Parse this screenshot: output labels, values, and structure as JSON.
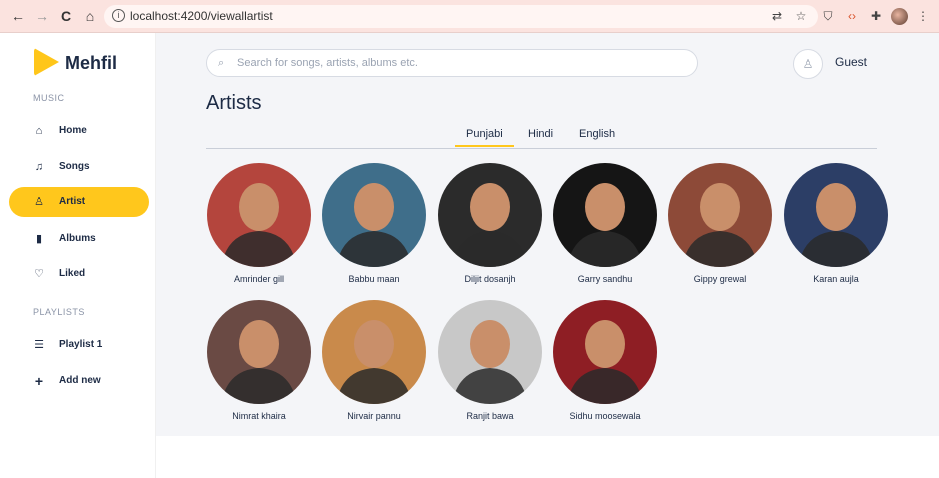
{
  "browser": {
    "url": "localhost:4200/viewallartist",
    "back": "←",
    "forward": "→",
    "reload": "C",
    "home": "⌂"
  },
  "sidebar": {
    "brand": "Mehfil",
    "music_section": "MUSIC",
    "playlists_section": "PLAYLISTS",
    "items": [
      {
        "label": "Home",
        "icon": "home-icon",
        "glyph": "⌂"
      },
      {
        "label": "Songs",
        "icon": "music-note-icon",
        "glyph": "♫"
      },
      {
        "label": "Artist",
        "icon": "person-icon",
        "glyph": "♙"
      },
      {
        "label": "Albums",
        "icon": "book-icon",
        "glyph": "▮"
      },
      {
        "label": "Liked",
        "icon": "heart-icon",
        "glyph": "♡"
      }
    ],
    "playlists": [
      {
        "label": "Playlist 1",
        "icon": "list-icon",
        "glyph": "☰"
      },
      {
        "label": "Add new",
        "icon": "plus-icon",
        "glyph": "+"
      }
    ],
    "active_item": "Artist",
    "accent": "#ffc71c"
  },
  "header": {
    "search_placeholder": "Search for songs, artists, albums etc.",
    "user": "Guest"
  },
  "page": {
    "title": "Artists",
    "tabs": [
      "Punjabi",
      "Hindi",
      "English"
    ],
    "active_tab": "Punjabi"
  },
  "artists": [
    {
      "name": "Amrinder gill",
      "tone": "#b4453d"
    },
    {
      "name": "Babbu maan",
      "tone": "#3f6e8a"
    },
    {
      "name": "Diljit dosanjh",
      "tone": "#2b2b2b"
    },
    {
      "name": "Garry sandhu",
      "tone": "#151515"
    },
    {
      "name": "Gippy grewal",
      "tone": "#8d4a38"
    },
    {
      "name": "Karan aujla",
      "tone": "#2c3e66"
    },
    {
      "name": "Nimrat khaira",
      "tone": "#6a4a44"
    },
    {
      "name": "Nirvair pannu",
      "tone": "#c98a4b"
    },
    {
      "name": "Ranjit bawa",
      "tone": "#c8c8c8"
    },
    {
      "name": "Sidhu moosewala",
      "tone": "#8e1e24"
    }
  ]
}
